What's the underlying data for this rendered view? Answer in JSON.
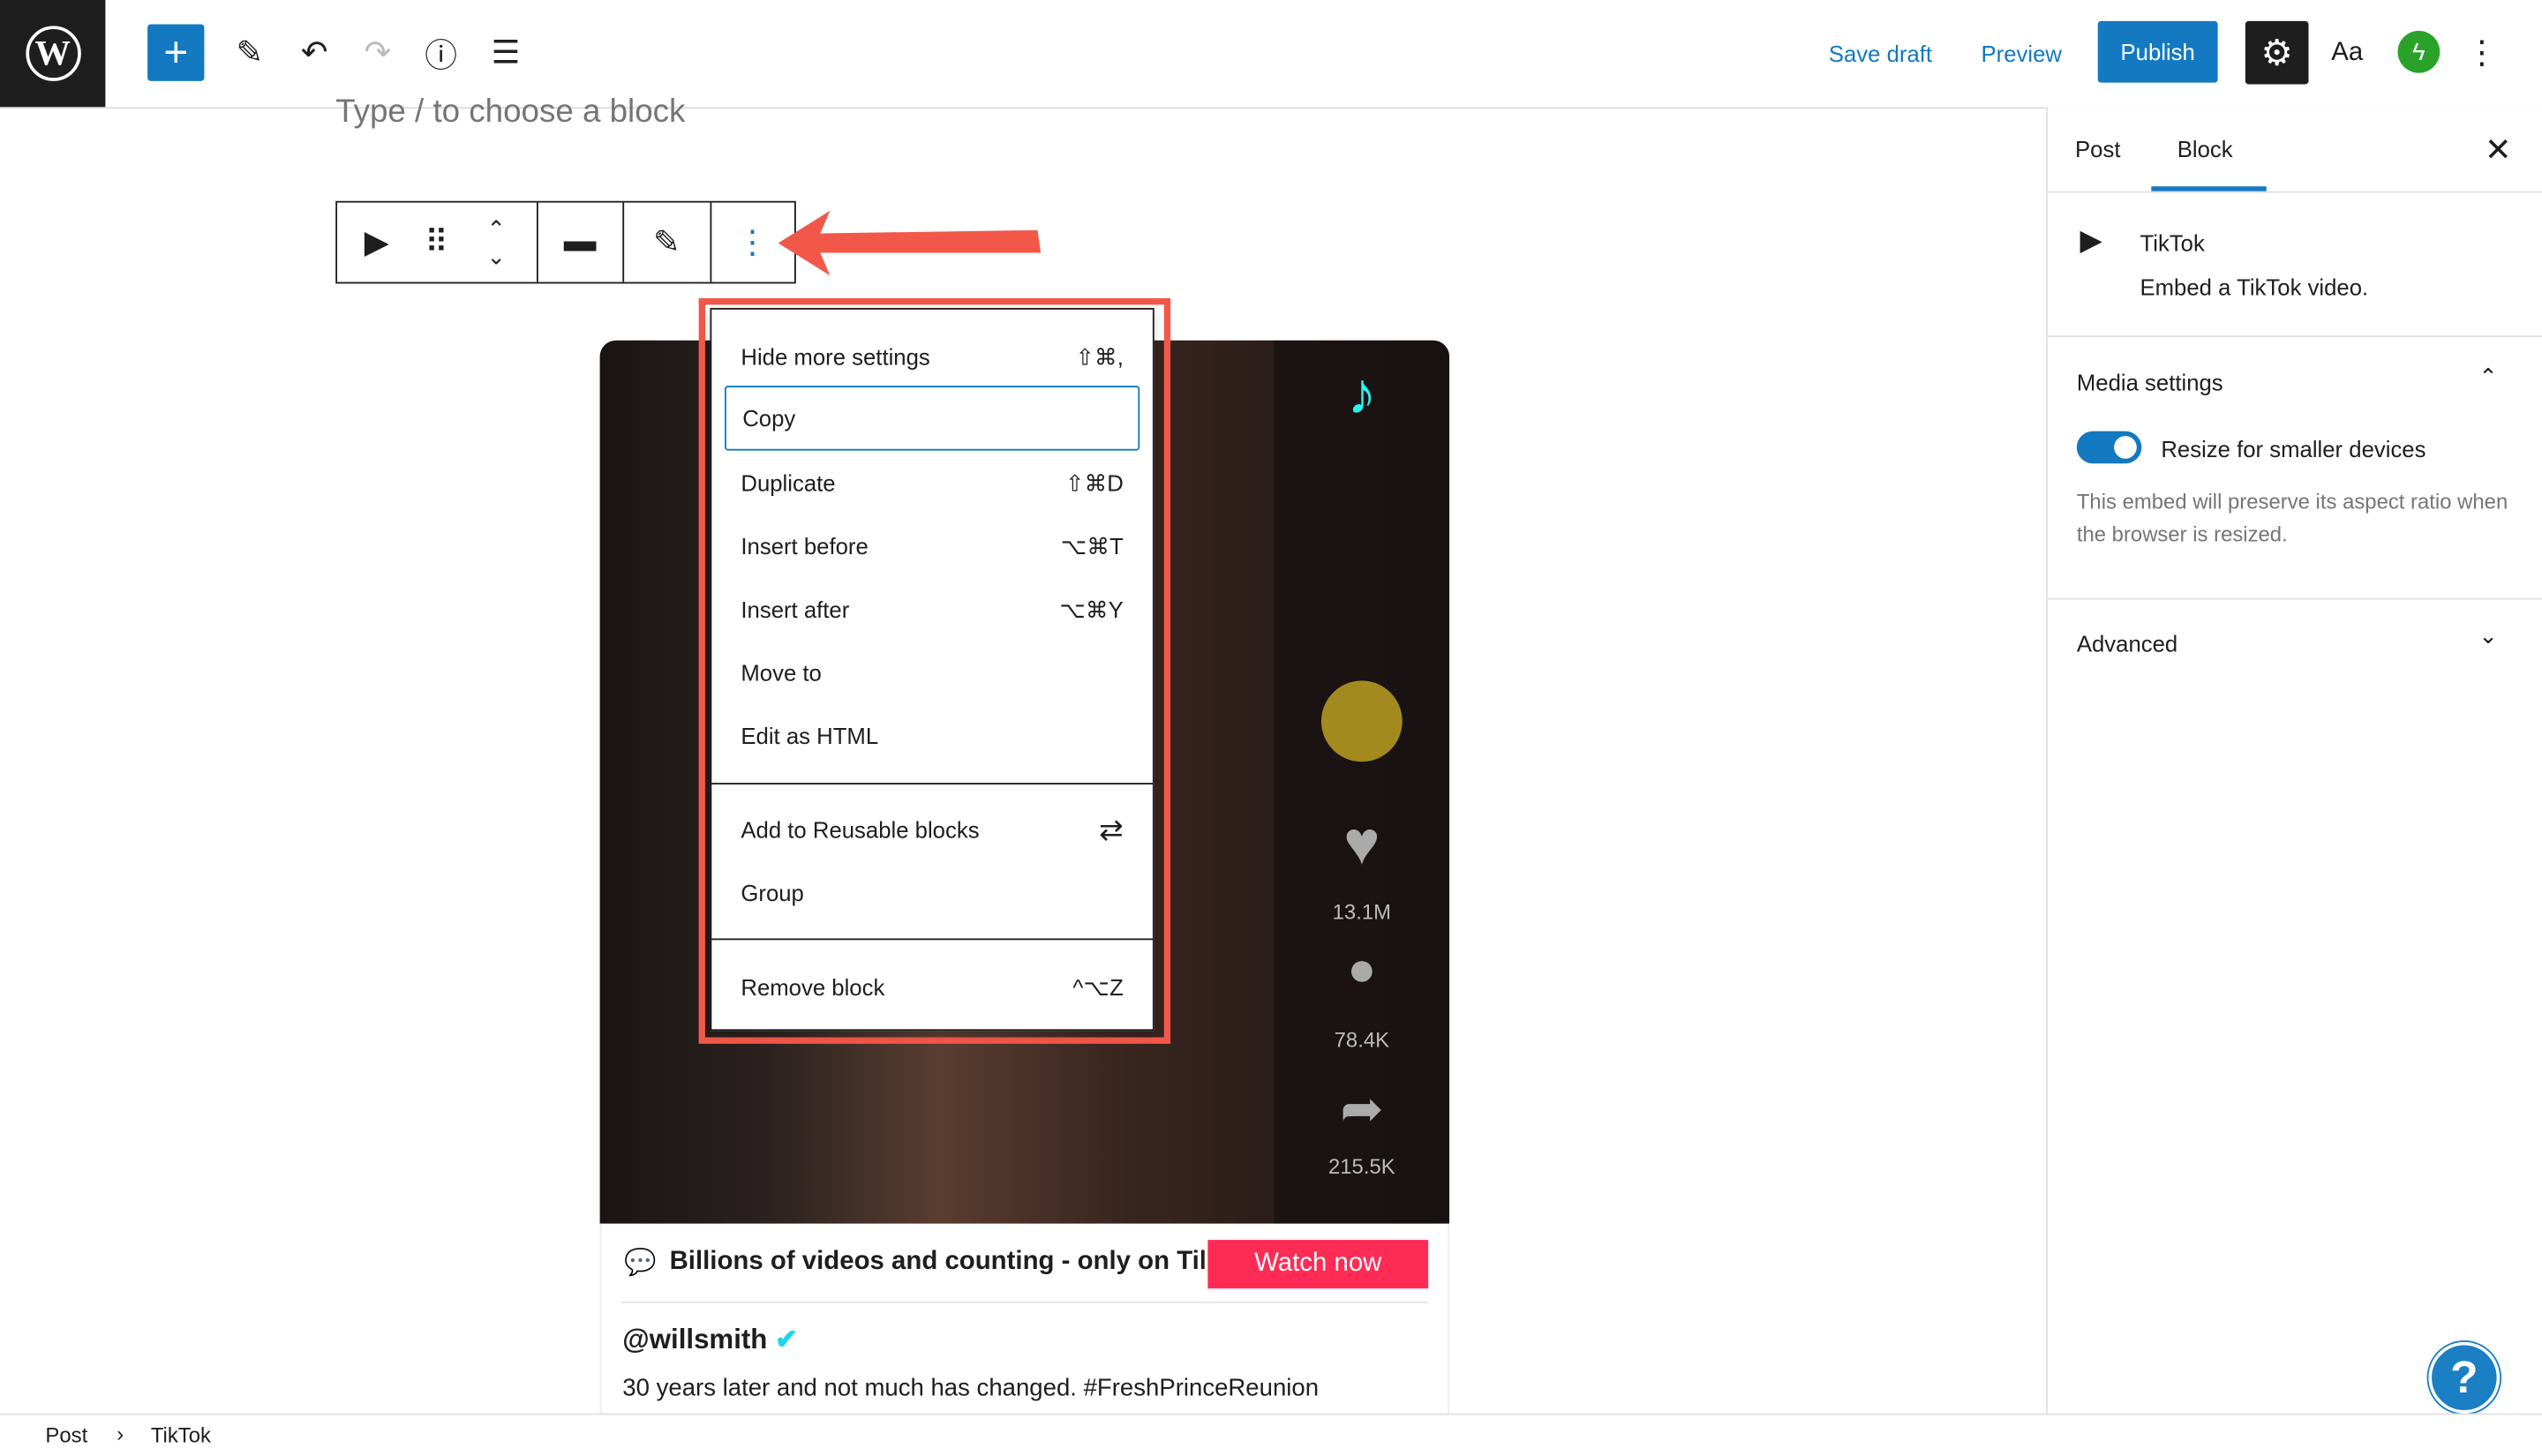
{
  "topbar": {
    "save_draft": "Save draft",
    "preview": "Preview",
    "publish": "Publish",
    "styles": "Aa"
  },
  "editor": {
    "placeholder": "Type / to choose a block"
  },
  "menu": {
    "items": [
      {
        "label": "Hide more settings",
        "shortcut": "⇧⌘,"
      },
      {
        "label": "Copy",
        "shortcut": ""
      },
      {
        "label": "Duplicate",
        "shortcut": "⇧⌘D"
      },
      {
        "label": "Insert before",
        "shortcut": "⌥⌘T"
      },
      {
        "label": "Insert after",
        "shortcut": "⌥⌘Y"
      },
      {
        "label": "Move to",
        "shortcut": ""
      },
      {
        "label": "Edit as HTML",
        "shortcut": ""
      },
      {
        "label": "Add to Reusable blocks",
        "shortcut": ""
      },
      {
        "label": "Group",
        "shortcut": ""
      },
      {
        "label": "Remove block",
        "shortcut": "^⌥Z"
      }
    ]
  },
  "embed": {
    "likes": "13.1M",
    "comments": "78.4K",
    "shares": "215.5K",
    "banner": "Billions of videos and counting - only on TikTok",
    "watch": "Watch now",
    "user": "@willsmith",
    "caption": "30 years later and not much has changed. #FreshPrinceReunion"
  },
  "sidebar": {
    "tabs": [
      "Post",
      "Block"
    ],
    "block_name": "TikTok",
    "block_desc": "Embed a TikTok video.",
    "media_settings": "Media settings",
    "toggle_label": "Resize for smaller devices",
    "toggle_on": true,
    "help": "This embed will preserve its aspect ratio when the browser is resized.",
    "advanced": "Advanced"
  },
  "breadcrumb": [
    "Post",
    "TikTok"
  ],
  "colors": {
    "accent": "#1379c0",
    "annotation": "#f2584a",
    "tiktok": "#fe2c55"
  }
}
